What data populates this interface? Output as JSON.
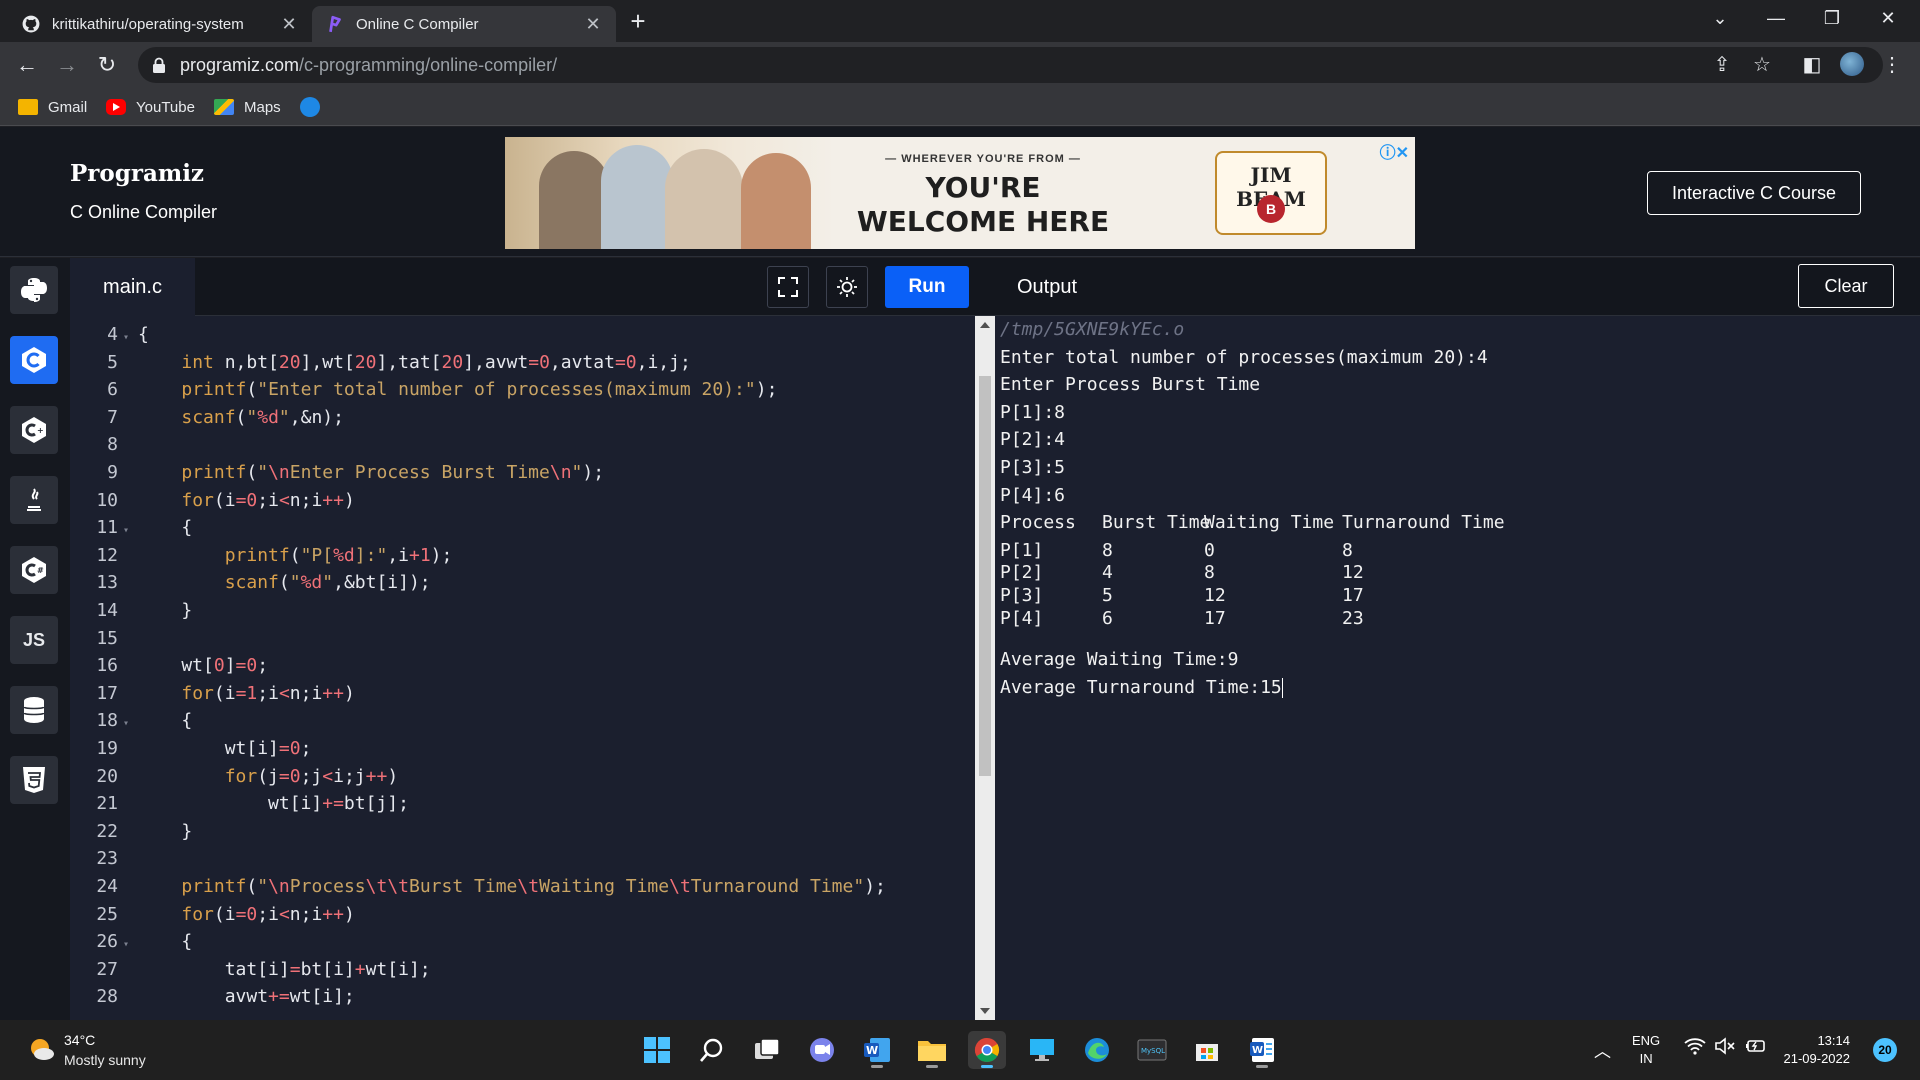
{
  "browser": {
    "tabs": [
      {
        "title": "krittikathiru/operating-system",
        "icon": "github-icon"
      },
      {
        "title": "Online C Compiler",
        "icon": "programiz-icon"
      }
    ],
    "url_domain": "programiz.com",
    "url_path": "/c-programming/online-compiler/",
    "bookmarks": [
      {
        "label": "Gmail",
        "icon": "gmail-icon"
      },
      {
        "label": "YouTube",
        "icon": "youtube-icon"
      },
      {
        "label": "Maps",
        "icon": "maps-icon"
      },
      {
        "label": "",
        "icon": "chat-bookmark-icon"
      }
    ]
  },
  "site": {
    "logo": "Programiz",
    "subtitle": "C Online Compiler",
    "course_button": "Interactive C Course"
  },
  "ad": {
    "tagline_small": "— WHEREVER YOU'RE FROM —",
    "headline": "YOU'RE WELCOME HERE",
    "brand": "JIM BEAM",
    "brand_seal": "B"
  },
  "rail": [
    {
      "name": "python",
      "icon": "python-icon",
      "label": ""
    },
    {
      "name": "c",
      "icon": "c-icon",
      "label": "",
      "active": true
    },
    {
      "name": "cpp",
      "icon": "cpp-icon",
      "label": ""
    },
    {
      "name": "java",
      "icon": "java-icon",
      "label": ""
    },
    {
      "name": "csharp",
      "icon": "csharp-icon",
      "label": ""
    },
    {
      "name": "javascript",
      "icon": "js-icon",
      "label": "JS"
    },
    {
      "name": "sql",
      "icon": "database-icon",
      "label": ""
    },
    {
      "name": "html",
      "icon": "html5-icon",
      "label": ""
    }
  ],
  "editor": {
    "file_tab": "main.c",
    "run_label": "Run",
    "lines": [
      {
        "n": "4",
        "fold": true,
        "code": "{"
      },
      {
        "n": "5",
        "fold": false,
        "code": "    int n,bt[20],wt[20],tat[20],avwt=0,avtat=0,i,j;"
      },
      {
        "n": "6",
        "fold": false,
        "code": "    printf(\"Enter total number of processes(maximum 20):\");"
      },
      {
        "n": "7",
        "fold": false,
        "code": "    scanf(\"%d\",&n);"
      },
      {
        "n": "8",
        "fold": false,
        "code": ""
      },
      {
        "n": "9",
        "fold": false,
        "code": "    printf(\"\\nEnter Process Burst Time\\n\");"
      },
      {
        "n": "10",
        "fold": false,
        "code": "    for(i=0;i<n;i++)"
      },
      {
        "n": "11",
        "fold": true,
        "code": "    {"
      },
      {
        "n": "12",
        "fold": false,
        "code": "        printf(\"P[%d]:\",i+1);"
      },
      {
        "n": "13",
        "fold": false,
        "code": "        scanf(\"%d\",&bt[i]);"
      },
      {
        "n": "14",
        "fold": false,
        "code": "    }"
      },
      {
        "n": "15",
        "fold": false,
        "code": ""
      },
      {
        "n": "16",
        "fold": false,
        "code": "    wt[0]=0;"
      },
      {
        "n": "17",
        "fold": false,
        "code": "    for(i=1;i<n;i++)"
      },
      {
        "n": "18",
        "fold": true,
        "code": "    {"
      },
      {
        "n": "19",
        "fold": false,
        "code": "        wt[i]=0;"
      },
      {
        "n": "20",
        "fold": false,
        "code": "        for(j=0;j<i;j++)"
      },
      {
        "n": "21",
        "fold": false,
        "code": "            wt[i]+=bt[j];"
      },
      {
        "n": "22",
        "fold": false,
        "code": "    }"
      },
      {
        "n": "23",
        "fold": false,
        "code": ""
      },
      {
        "n": "24",
        "fold": false,
        "code": "    printf(\"\\nProcess\\t\\tBurst Time\\tWaiting Time\\tTurnaround Time\");"
      },
      {
        "n": "25",
        "fold": false,
        "code": "    for(i=0;i<n;i++)"
      },
      {
        "n": "26",
        "fold": true,
        "code": "    {"
      },
      {
        "n": "27",
        "fold": false,
        "code": "        tat[i]=bt[i]+wt[i];"
      },
      {
        "n": "28",
        "fold": false,
        "code": "        avwt+=wt[i];"
      }
    ]
  },
  "output": {
    "title": "Output",
    "clear_label": "Clear",
    "path": "/tmp/5GXNE9kYEc.o",
    "lines_before": [
      "Enter total number of processes(maximum 20):4",
      "Enter Process Burst Time",
      "P[1]:8",
      "P[2]:4",
      "P[3]:5",
      "P[4]:6"
    ],
    "table_header": [
      "Process",
      "Burst Time",
      "Waiting Time",
      "Turnaround Time"
    ],
    "table_rows": [
      [
        "P[1]",
        "8",
        "0",
        "8"
      ],
      [
        "P[2]",
        "4",
        "8",
        "12"
      ],
      [
        "P[3]",
        "5",
        "12",
        "17"
      ],
      [
        "P[4]",
        "6",
        "17",
        "23"
      ]
    ],
    "avg_wait": "Average Waiting Time:9",
    "avg_tat": "Average Turnaround Time:15"
  },
  "taskbar": {
    "temperature": "34°C",
    "weather": "Mostly sunny",
    "apps": [
      "windows-start-icon",
      "search-icon",
      "task-view-icon",
      "teams-chat-icon",
      "word-icon",
      "file-explorer-icon",
      "chrome-icon",
      "desktop-icon",
      "edge-icon",
      "mysql-icon",
      "store-icon",
      "word-doc-icon"
    ],
    "lang_line1": "ENG",
    "lang_line2": "IN",
    "time": "13:14",
    "date": "21-09-2022",
    "notifications": "20"
  }
}
